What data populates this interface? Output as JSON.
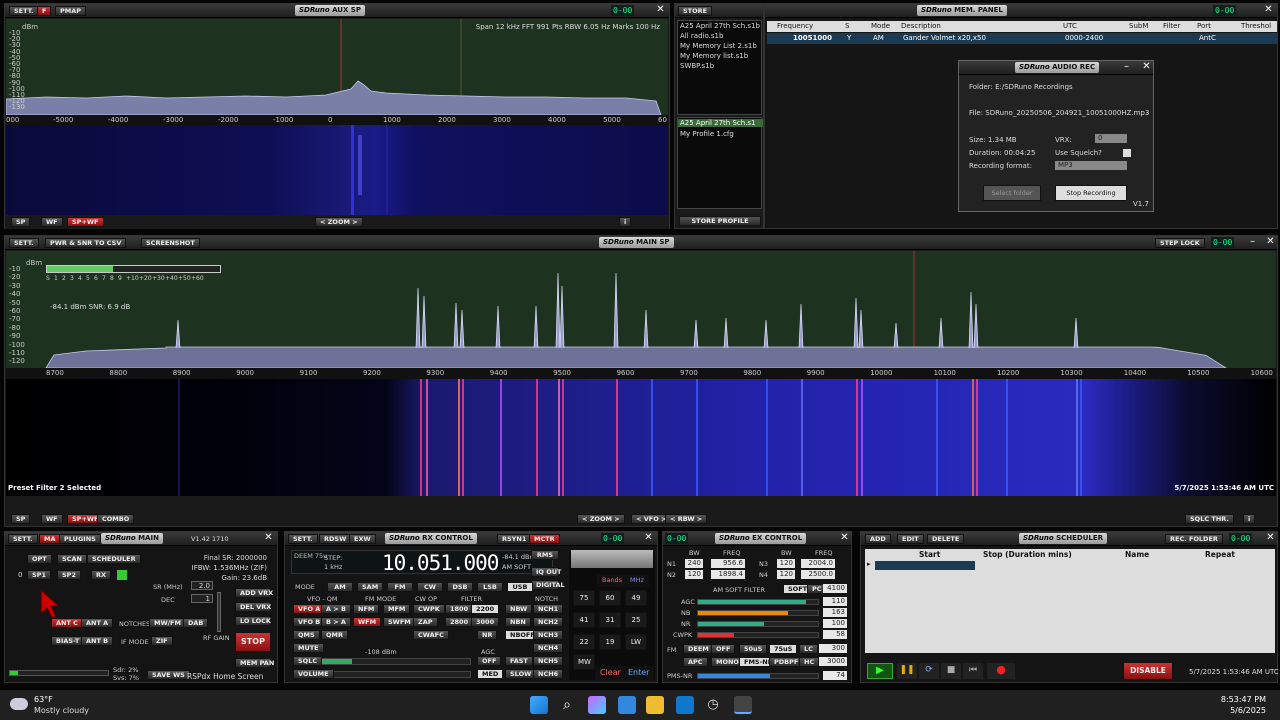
{
  "aux": {
    "sett": "SETT.",
    "f": "F",
    "pmap": "PMAP",
    "title": "AUX SP",
    "info": "Span 12 kHz   FFT 991 Pts   RBW 6.05 Hz   Marks 100 Hz",
    "dbm": "dBm",
    "y": [
      "-10",
      "-20",
      "-30",
      "-40",
      "-50",
      "-60",
      "-70",
      "-80",
      "-90",
      "-100",
      "-110",
      "-120",
      "-130"
    ],
    "x": [
      "000",
      "-5000",
      "-4000",
      "-3000",
      "-2000",
      "-1000",
      "0",
      "1000",
      "2000",
      "3000",
      "4000",
      "5000",
      "60"
    ],
    "sp": "SP",
    "wf": "WF",
    "spwf": "SP+WF",
    "zoom": "ZOOM",
    "lcd": "0-00"
  },
  "store": {
    "title": "STORE",
    "files": [
      "A25 April 27th Sch.s1b",
      "All radio.s1b",
      "My Memory List 2.s1b",
      "My Memory list.s1b",
      "SWBP.s1b"
    ],
    "selected": "A25 April 27th Sch.s1",
    "profile": "My Profile 1.cfg",
    "profile_btn": "STORE PROFILE"
  },
  "mem": {
    "title": "MEM. PANEL",
    "cols": [
      "Frequency",
      "S",
      "Mode",
      "Description",
      "UTC",
      "SubM",
      "Filter",
      "Port",
      "Threshol"
    ],
    "row": [
      "10051000",
      "Y",
      "AM",
      "Gander Volmet x20,x50",
      "0000-2400",
      "",
      "",
      "AntC",
      ""
    ]
  },
  "rec": {
    "title": "AUDIO REC",
    "folder": "Folder: E:/SDRuno Recordings",
    "file": "File: SDRuno_20250506_204921_10051000HZ.mp3",
    "size": "Size: 1.34 MB",
    "duration": "Duration: 00:04:25",
    "format": "Recording format:",
    "vrx": "VRX:",
    "vrx_val": "0",
    "squelch": "Use Squelch?",
    "fmt_val": "MP3",
    "select": "Select folder",
    "stop": "Stop Recording",
    "ver": "V1.7"
  },
  "main": {
    "sett": "SETT.",
    "pwr": "PWR & SNR TO CSV",
    "shot": "SCREENSHOT",
    "title": "MAIN SP",
    "steplock": "STEP LOCK",
    "dbm": "dBm",
    "smeter": [
      "S",
      "1",
      "2",
      "3",
      "4",
      "5",
      "6",
      "7",
      "8",
      "9",
      "+10",
      "+20",
      "+30",
      "+40",
      "+50",
      "+60"
    ],
    "level": "-84.1 dBm    SNR: 6.9 dB",
    "y": [
      "-10",
      "-20",
      "-30",
      "-40",
      "-50",
      "-60",
      "-70",
      "-80",
      "-90",
      "-100",
      "-110",
      "-120"
    ],
    "x": [
      "8700",
      "8800",
      "8900",
      "9000",
      "9100",
      "9200",
      "9300",
      "9400",
      "9500",
      "9600",
      "9700",
      "9800",
      "9900",
      "10000",
      "10100",
      "10200",
      "10300",
      "10400",
      "10500",
      "10600"
    ],
    "preset": "Preset Filter 2 Selected",
    "date": "5/7/2025 1:53:46 AM UTC",
    "sp": "SP",
    "wf": "WF",
    "spwf": "SP+WF",
    "combo": "COMBO",
    "zoom": "ZOOM",
    "vfo": "VFO",
    "rbw": "RBW",
    "sqlc": "SQLC THR.",
    "lcd": "0-00"
  },
  "mainp": {
    "sett": "SETT.",
    "ma": "MA",
    "plugins": "PLUGINS",
    "title": "MAIN",
    "ver": "V1.42 1710",
    "opt": "OPT",
    "scan": "SCAN",
    "sched": "SCHEDULER",
    "zero": "0",
    "sp1": "SP1",
    "sp2": "SP2",
    "rx": "RX",
    "final": "Final SR: 2000000",
    "ifbw": "IFBW: 1.536MHz (ZIF)",
    "gain": "Gain: 23.6dB",
    "sr": "SR (MHz)",
    "sr_val": "2.0",
    "dec": "DEC",
    "dec_val": "1",
    "add": "ADD VRX",
    "del": "DEL VRX",
    "lo": "LO LOCK",
    "antc": "ANT C",
    "anta": "ANT A",
    "notches": "NOTCHES",
    "mwfm": "MW/FM",
    "dab": "DAB",
    "biast": "BIAS-T",
    "antb": "ANT B",
    "ifmode": "IF MODE",
    "zif": "ZIF",
    "rfgain": "RF GAIN",
    "stop": "STOP",
    "mempan": "MEM PAN",
    "sdr": "Sdr: 2%",
    "svs": "Svs: 7%",
    "save": "SAVE WS",
    "home": "RSPdx Home Screen"
  },
  "rx": {
    "sett": "SETT.",
    "rdsw": "RDSW",
    "exw": "EXW",
    "title": "RX CONTROL",
    "rsyn": "RSYN1",
    "mctr": "MCTR",
    "deem": "DEEM 75u",
    "step": "STEP:",
    "step_val": "1 kHz",
    "freq": "10.051.000",
    "lvl": "-84.1 dBm",
    "amsoft": "AM SOFT",
    "rms": "RMS",
    "iq": "IQ OUT",
    "digital": "DIGITAL",
    "mode": "MODE",
    "modes": [
      "AM",
      "SAM",
      "FM",
      "CW",
      "DSB",
      "LSB",
      "USB"
    ],
    "vfoqm": "VFO - QM",
    "fmmode": "FM MODE",
    "cwop": "CW OP",
    "filter": "FILTER",
    "notch": "NOTCH",
    "vfoa": "VFO A",
    "atob": "A > B",
    "nfm": "NFM",
    "mfm": "MFM",
    "cwpk": "CWPK",
    "f1800": "1800",
    "f2200": "2200",
    "nbw": "NBW",
    "nch1": "NCH1",
    "vfob": "VFO B",
    "btoa": "B > A",
    "wfm": "WFM",
    "swfm": "SWFM",
    "zap": "ZAP",
    "f2800": "2800",
    "f3000": "3000",
    "nbn": "NBN",
    "nch2": "NCH2",
    "qms": "QMS",
    "qmr": "QMR",
    "cwafc": "CWAFC",
    "nr": "NR",
    "nboff": "NBOFF",
    "nch3": "NCH3",
    "mute": "MUTE",
    "agc": "AGC",
    "nch4": "NCH4",
    "sqlc": "SQLC",
    "sqldbm": "-108 dBm",
    "off": "OFF",
    "fast": "FAST",
    "nch5": "NCH5",
    "volume": "VOLUME",
    "med": "MED",
    "slow": "SLOW",
    "nch6": "NCH6",
    "bands": "Bands",
    "mhz": "MHz",
    "clear": "Clear",
    "enter": "Enter",
    "keys": [
      "75",
      "60",
      "49",
      "41",
      "31",
      "25",
      "22",
      "19",
      "LW",
      "MW"
    ],
    "lcd": "0-00"
  },
  "ex": {
    "title": "EX CONTROL",
    "lcd": "0-00",
    "bw": "BW",
    "freq": "FREQ",
    "n1": "N1",
    "n1bw": "240",
    "n1f": "956.6",
    "n3": "N3",
    "n3bw": "120",
    "n3f": "2004.0",
    "n2": "N2",
    "n2bw": "120",
    "n2f": "1898.4",
    "n4": "N4",
    "n4bw": "120",
    "n4f": "2500.0",
    "amsoft": "AM SOFT FILTER",
    "soft": "SOFT",
    "pc": "PC",
    "pcv": "4100",
    "agc": "AGC",
    "agcv": "110",
    "nb": "NB",
    "nbv": "163",
    "nr": "NR",
    "nrv": "100",
    "cwpk": "CWPK",
    "cwpkv": "58",
    "fm": "FM",
    "deem": "DEEM",
    "off": "OFF",
    "u50": "50uS",
    "u75": "75uS",
    "lc": "LC",
    "lcv": "300",
    "apc": "APC",
    "mono": "MONO",
    "fmsnr": "FMS-NR",
    "pdbpf": "PDBPF",
    "hc": "HC",
    "hcv": "3000",
    "pmsnr": "PMS-NR",
    "pmsv": "74"
  },
  "sched": {
    "add": "ADD",
    "edit": "EDIT",
    "delete": "DELETE",
    "title": "SCHEDULER",
    "recfolder": "REC. FOLDER",
    "cols": [
      "Start",
      "Stop (Duration mins)",
      "Name",
      "Repeat"
    ],
    "disable": "DISABLE",
    "date": "5/7/2025 1:53:46 AM UTC",
    "lcd": "0-00"
  },
  "task": {
    "temp": "63°F",
    "weather": "Mostly cloudy",
    "time": "8:53:47 PM",
    "date": "5/6/2025"
  }
}
